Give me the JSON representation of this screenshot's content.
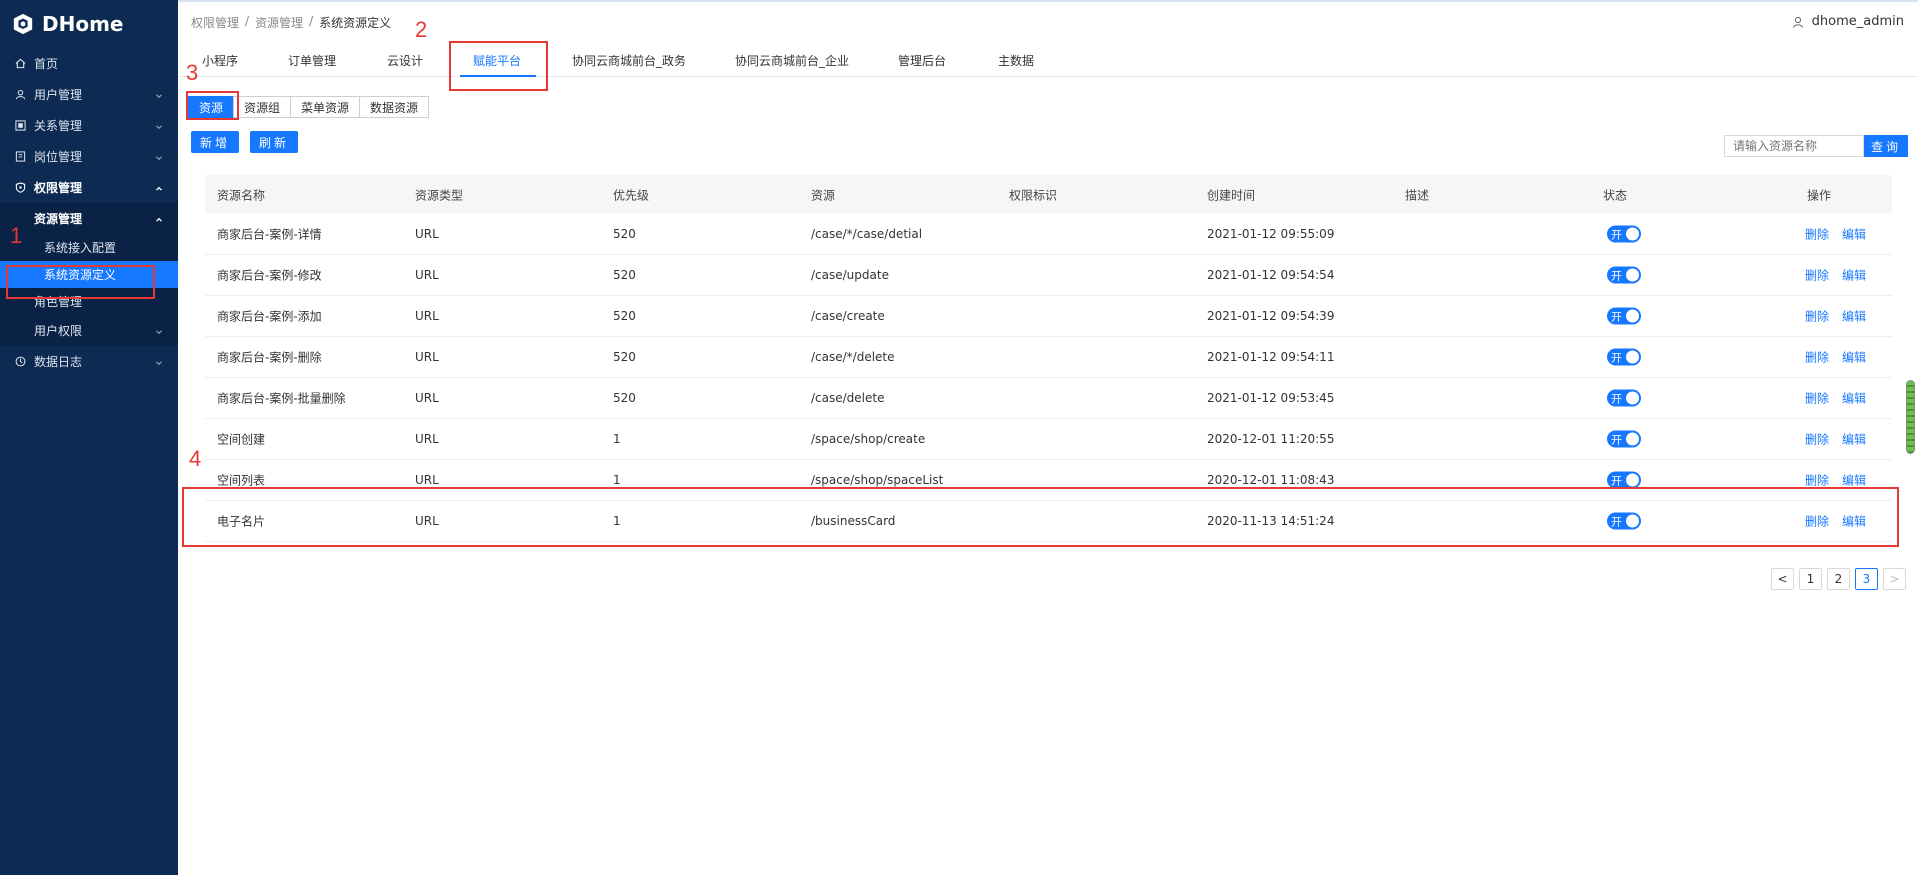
{
  "app": {
    "title": "DHome"
  },
  "sidebar": {
    "items": [
      {
        "label": "首页",
        "icon": "home-icon",
        "level": 0,
        "chevron": false
      },
      {
        "label": "用户管理",
        "icon": "user-icon",
        "level": 0,
        "chevron": "down"
      },
      {
        "label": "关系管理",
        "icon": "relation-icon",
        "level": 0,
        "chevron": "down"
      },
      {
        "label": "岗位管理",
        "icon": "post-icon",
        "level": 0,
        "chevron": "down"
      },
      {
        "label": "权限管理",
        "icon": "shield-icon",
        "level": 0,
        "chevron": "up",
        "bold": true
      },
      {
        "label": "资源管理",
        "level": 1,
        "chevron": "up",
        "bold": true
      },
      {
        "label": "系统接入配置",
        "level": 2,
        "chevron": false
      },
      {
        "label": "系统资源定义",
        "level": 2,
        "chevron": false,
        "active": true
      },
      {
        "label": "角色管理",
        "level": 1,
        "chevron": false
      },
      {
        "label": "用户权限",
        "level": 1,
        "chevron": "down"
      },
      {
        "label": "数据日志",
        "icon": "log-icon",
        "level": 0,
        "chevron": "down"
      }
    ]
  },
  "header": {
    "breadcrumb": [
      "权限管理",
      "资源管理",
      "系统资源定义"
    ],
    "separator": "/",
    "username": "dhome_admin"
  },
  "tabs": [
    "小程序",
    "订单管理",
    "云设计",
    "赋能平台",
    "协同云商城前台_政务",
    "协同云商城前台_企业",
    "管理后台",
    "主数据"
  ],
  "active_tab": "赋能平台",
  "subtabs": [
    "资源",
    "资源组",
    "菜单资源",
    "数据资源"
  ],
  "active_subtab": "资源",
  "toolbar": {
    "add_label": "新增",
    "refresh_label": "刷新",
    "search_placeholder": "请输入资源名称",
    "search_label": "查询"
  },
  "table": {
    "columns": [
      "资源名称",
      "资源类型",
      "优先级",
      "资源",
      "权限标识",
      "创建时间",
      "描述",
      "状态",
      "操作"
    ],
    "rows": [
      {
        "name": "商家后台-案例-详情",
        "type": "URL",
        "priority": "520",
        "resource": "/case/*/case/detial",
        "perm": "",
        "created": "2021-01-12 09:55:09",
        "desc": "",
        "status": "开"
      },
      {
        "name": "商家后台-案例-修改",
        "type": "URL",
        "priority": "520",
        "resource": "/case/update",
        "perm": "",
        "created": "2021-01-12 09:54:54",
        "desc": "",
        "status": "开"
      },
      {
        "name": "商家后台-案例-添加",
        "type": "URL",
        "priority": "520",
        "resource": "/case/create",
        "perm": "",
        "created": "2021-01-12 09:54:39",
        "desc": "",
        "status": "开"
      },
      {
        "name": "商家后台-案例-删除",
        "type": "URL",
        "priority": "520",
        "resource": "/case/*/delete",
        "perm": "",
        "created": "2021-01-12 09:54:11",
        "desc": "",
        "status": "开"
      },
      {
        "name": "商家后台-案例-批量删除",
        "type": "URL",
        "priority": "520",
        "resource": "/case/delete",
        "perm": "",
        "created": "2021-01-12 09:53:45",
        "desc": "",
        "status": "开"
      },
      {
        "name": "空间创建",
        "type": "URL",
        "priority": "1",
        "resource": "/space/shop/create",
        "perm": "",
        "created": "2020-12-01 11:20:55",
        "desc": "",
        "status": "开"
      },
      {
        "name": "空间列表",
        "type": "URL",
        "priority": "1",
        "resource": "/space/shop/spaceList",
        "perm": "",
        "created": "2020-12-01 11:08:43",
        "desc": "",
        "status": "开"
      },
      {
        "name": "电子名片",
        "type": "URL",
        "priority": "1",
        "resource": "/businessCard",
        "perm": "",
        "created": "2020-11-13 14:51:24",
        "desc": "",
        "status": "开"
      }
    ],
    "row_actions": [
      "删除",
      "编辑"
    ]
  },
  "pagination": {
    "prev": "<",
    "pages": [
      "1",
      "2",
      "3"
    ],
    "current": "3",
    "next": ">"
  },
  "annotations": [
    "1",
    "2",
    "3",
    "4"
  ],
  "colors": {
    "sidebar_bg": "#0d2a52",
    "accent": "#1677ff",
    "annotation": "#e53935"
  }
}
